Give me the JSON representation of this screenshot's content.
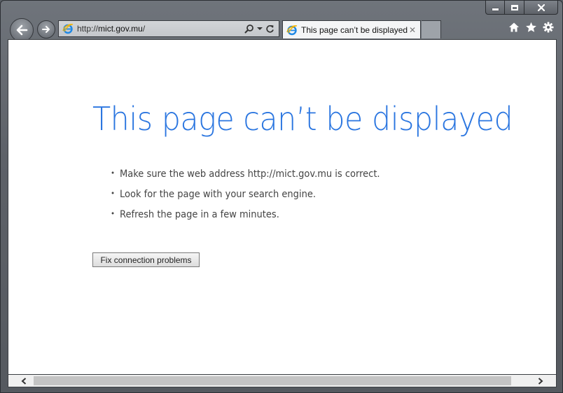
{
  "window": {
    "caption_buttons": [
      "minimize-icon",
      "maximize-icon",
      "close-icon"
    ]
  },
  "navigation": {
    "back_icon": "arrow-left-icon",
    "forward_icon": "arrow-right-icon"
  },
  "address_bar": {
    "scheme": "http://",
    "domain": "mict.gov.mu",
    "path": "/",
    "icons": [
      "ie-icon",
      "search-icon",
      "dropdown-icon",
      "refresh-icon"
    ]
  },
  "tab": {
    "title": "This page can’t be displayed",
    "close_label": "✕"
  },
  "toolbar": {
    "icons": [
      "home-icon",
      "favorites-star-icon",
      "settings-gear-icon"
    ]
  },
  "page": {
    "title": "This page can’t be displayed",
    "tips": [
      "Make sure the web address http://mict.gov.mu is correct.",
      "Look for the page with your search engine.",
      "Refresh the page in a few minutes."
    ],
    "fix_button_label": "Fix connection problems"
  },
  "colors": {
    "title_blue": "#2b76e0",
    "chrome_gray": "#5d6168",
    "content_bg": "#ffffff"
  }
}
